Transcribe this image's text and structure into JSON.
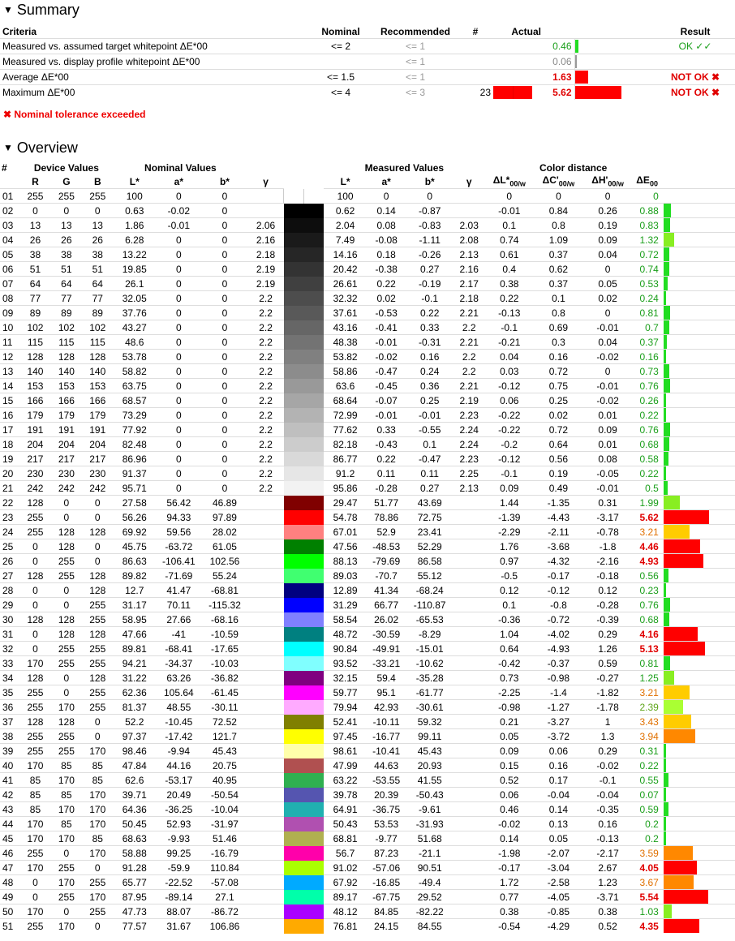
{
  "summary": {
    "title": "Summary",
    "headers": {
      "criteria": "Criteria",
      "nominal": "Nominal",
      "recommended": "Recommended",
      "count": "#",
      "actual": "Actual",
      "result": "Result"
    },
    "rows": [
      {
        "criteria": "Measured vs. assumed target whitepoint ΔE*00",
        "nominal": "<= 2",
        "recommended": "<= 1",
        "count": "",
        "actual": "0.46",
        "actual_color": "#1a9e1a",
        "result": "OK ✓✓",
        "result_color": "#1a9e1a",
        "bar_color": "#22dd22",
        "bar_fraction": 0.04,
        "count_bar": 0
      },
      {
        "criteria": "Measured vs. display profile whitepoint ΔE*00",
        "nominal": "",
        "recommended": "<= 1",
        "count": "",
        "actual": "0.06",
        "actual_color": "#888888",
        "result": "",
        "result_color": "#000000",
        "bar_color": "#999999",
        "bar_fraction": 0.01,
        "count_bar": 0
      },
      {
        "criteria": "Average ΔE*00",
        "nominal": "<= 1.5",
        "recommended": "<= 1",
        "count": "",
        "actual": "1.63",
        "actual_color": "#e00000",
        "result": "NOT OK ✖",
        "result_color": "#e00000",
        "bar_color": "#ff0000",
        "bar_fraction": 0.15,
        "count_bar": 0
      },
      {
        "criteria": "Maximum ΔE*00",
        "nominal": "<= 4",
        "recommended": "<= 3",
        "count": "23",
        "actual": "5.62",
        "actual_color": "#e00000",
        "result": "NOT OK ✖",
        "result_color": "#e00000",
        "bar_color": "#ff0000",
        "bar_fraction": 0.55,
        "count_bar": 1
      }
    ],
    "warning": "✖ Nominal tolerance exceeded"
  },
  "overview": {
    "title": "Overview",
    "group_headers": {
      "num": "#",
      "device": "Device Values",
      "nominal": "Nominal Values",
      "measured": "Measured Values",
      "distance": "Color distance"
    },
    "col_headers": {
      "r": "R",
      "g": "G",
      "b": "B",
      "l": "L*",
      "a": "a*",
      "bb": "b*",
      "gamma": "γ",
      "dl": "ΔL*",
      "dc": "ΔC'",
      "dh": "ΔH'",
      "de": "ΔE",
      "sub_w": "00/w",
      "sub_00": "00"
    },
    "rows": [
      [
        "01",
        "255",
        "255",
        "255",
        "100",
        "0",
        "0",
        "",
        "#ffffff",
        "#ffffff",
        "100",
        "0",
        "0",
        "",
        "0",
        "0",
        "0",
        "0"
      ],
      [
        "02",
        "0",
        "0",
        "0",
        "0.63",
        "-0.02",
        "0",
        "",
        "#000000",
        "#000000",
        "0.62",
        "0.14",
        "-0.87",
        "",
        "-0.01",
        "0.84",
        "0.26",
        "0.88"
      ],
      [
        "03",
        "13",
        "13",
        "13",
        "1.86",
        "-0.01",
        "0",
        "2.06",
        "#0d0d0d",
        "#0d0d0d",
        "2.04",
        "0.08",
        "-0.83",
        "2.03",
        "0.1",
        "0.8",
        "0.19",
        "0.83"
      ],
      [
        "04",
        "26",
        "26",
        "26",
        "6.28",
        "0",
        "0",
        "2.16",
        "#1a1a1a",
        "#1a1a1a",
        "7.49",
        "-0.08",
        "-1.11",
        "2.08",
        "0.74",
        "1.09",
        "0.09",
        "1.32"
      ],
      [
        "05",
        "38",
        "38",
        "38",
        "13.22",
        "0",
        "0",
        "2.18",
        "#262626",
        "#262626",
        "14.16",
        "0.18",
        "-0.26",
        "2.13",
        "0.61",
        "0.37",
        "0.04",
        "0.72"
      ],
      [
        "06",
        "51",
        "51",
        "51",
        "19.85",
        "0",
        "0",
        "2.19",
        "#333333",
        "#333333",
        "20.42",
        "-0.38",
        "0.27",
        "2.16",
        "0.4",
        "0.62",
        "0",
        "0.74"
      ],
      [
        "07",
        "64",
        "64",
        "64",
        "26.1",
        "0",
        "0",
        "2.19",
        "#404040",
        "#404040",
        "26.61",
        "0.22",
        "-0.19",
        "2.17",
        "0.38",
        "0.37",
        "0.05",
        "0.53"
      ],
      [
        "08",
        "77",
        "77",
        "77",
        "32.05",
        "0",
        "0",
        "2.2",
        "#4d4d4d",
        "#4d4d4d",
        "32.32",
        "0.02",
        "-0.1",
        "2.18",
        "0.22",
        "0.1",
        "0.02",
        "0.24"
      ],
      [
        "09",
        "89",
        "89",
        "89",
        "37.76",
        "0",
        "0",
        "2.2",
        "#595959",
        "#595959",
        "37.61",
        "-0.53",
        "0.22",
        "2.21",
        "-0.13",
        "0.8",
        "0",
        "0.81"
      ],
      [
        "10",
        "102",
        "102",
        "102",
        "43.27",
        "0",
        "0",
        "2.2",
        "#666666",
        "#666666",
        "43.16",
        "-0.41",
        "0.33",
        "2.2",
        "-0.1",
        "0.69",
        "-0.01",
        "0.7"
      ],
      [
        "11",
        "115",
        "115",
        "115",
        "48.6",
        "0",
        "0",
        "2.2",
        "#737373",
        "#737373",
        "48.38",
        "-0.01",
        "-0.31",
        "2.21",
        "-0.21",
        "0.3",
        "0.04",
        "0.37"
      ],
      [
        "12",
        "128",
        "128",
        "128",
        "53.78",
        "0",
        "0",
        "2.2",
        "#808080",
        "#808080",
        "53.82",
        "-0.02",
        "0.16",
        "2.2",
        "0.04",
        "0.16",
        "-0.02",
        "0.16"
      ],
      [
        "13",
        "140",
        "140",
        "140",
        "58.82",
        "0",
        "0",
        "2.2",
        "#8c8c8c",
        "#8c8c8c",
        "58.86",
        "-0.47",
        "0.24",
        "2.2",
        "0.03",
        "0.72",
        "0",
        "0.73"
      ],
      [
        "14",
        "153",
        "153",
        "153",
        "63.75",
        "0",
        "0",
        "2.2",
        "#999999",
        "#999999",
        "63.6",
        "-0.45",
        "0.36",
        "2.21",
        "-0.12",
        "0.75",
        "-0.01",
        "0.76"
      ],
      [
        "15",
        "166",
        "166",
        "166",
        "68.57",
        "0",
        "0",
        "2.2",
        "#a6a6a6",
        "#a6a6a6",
        "68.64",
        "-0.07",
        "0.25",
        "2.19",
        "0.06",
        "0.25",
        "-0.02",
        "0.26"
      ],
      [
        "16",
        "179",
        "179",
        "179",
        "73.29",
        "0",
        "0",
        "2.2",
        "#b3b3b3",
        "#b3b3b3",
        "72.99",
        "-0.01",
        "-0.01",
        "2.23",
        "-0.22",
        "0.02",
        "0.01",
        "0.22"
      ],
      [
        "17",
        "191",
        "191",
        "191",
        "77.92",
        "0",
        "0",
        "2.2",
        "#bfbfbf",
        "#bfbfbf",
        "77.62",
        "0.33",
        "-0.55",
        "2.24",
        "-0.22",
        "0.72",
        "0.09",
        "0.76"
      ],
      [
        "18",
        "204",
        "204",
        "204",
        "82.48",
        "0",
        "0",
        "2.2",
        "#cccccc",
        "#cccccc",
        "82.18",
        "-0.43",
        "0.1",
        "2.24",
        "-0.2",
        "0.64",
        "0.01",
        "0.68"
      ],
      [
        "19",
        "217",
        "217",
        "217",
        "86.96",
        "0",
        "0",
        "2.2",
        "#d9d9d9",
        "#d9d9d9",
        "86.77",
        "0.22",
        "-0.47",
        "2.23",
        "-0.12",
        "0.56",
        "0.08",
        "0.58"
      ],
      [
        "20",
        "230",
        "230",
        "230",
        "91.37",
        "0",
        "0",
        "2.2",
        "#e6e6e6",
        "#e6e6e6",
        "91.2",
        "0.11",
        "0.11",
        "2.25",
        "-0.1",
        "0.19",
        "-0.05",
        "0.22"
      ],
      [
        "21",
        "242",
        "242",
        "242",
        "95.71",
        "0",
        "0",
        "2.2",
        "#f2f2f2",
        "#f2f2f2",
        "95.86",
        "-0.28",
        "0.27",
        "2.13",
        "0.09",
        "0.49",
        "-0.01",
        "0.5"
      ],
      [
        "22",
        "128",
        "0",
        "0",
        "27.58",
        "56.42",
        "46.89",
        "",
        "#800000",
        "#800000",
        "29.47",
        "51.77",
        "43.69",
        "",
        "1.44",
        "-1.35",
        "0.31",
        "1.99"
      ],
      [
        "23",
        "255",
        "0",
        "0",
        "56.26",
        "94.33",
        "97.89",
        "",
        "#ff0000",
        "#ff0000",
        "54.78",
        "78.86",
        "72.75",
        "",
        "-1.39",
        "-4.43",
        "-3.17",
        "5.62"
      ],
      [
        "24",
        "255",
        "128",
        "128",
        "69.92",
        "59.56",
        "28.02",
        "",
        "#ff8080",
        "#ff8080",
        "67.01",
        "52.9",
        "23.41",
        "",
        "-2.29",
        "-2.11",
        "-0.78",
        "3.21"
      ],
      [
        "25",
        "0",
        "128",
        "0",
        "45.75",
        "-63.72",
        "61.05",
        "",
        "#008000",
        "#008000",
        "47.56",
        "-48.53",
        "52.29",
        "",
        "1.76",
        "-3.68",
        "-1.8",
        "4.46"
      ],
      [
        "26",
        "0",
        "255",
        "0",
        "86.63",
        "-106.41",
        "102.56",
        "",
        "#00ff00",
        "#00ff00",
        "88.13",
        "-79.69",
        "86.58",
        "",
        "0.97",
        "-4.32",
        "-2.16",
        "4.93"
      ],
      [
        "27",
        "128",
        "255",
        "128",
        "89.82",
        "-71.69",
        "55.24",
        "",
        "#40ff70",
        "#40ff70",
        "89.03",
        "-70.7",
        "55.12",
        "",
        "-0.5",
        "-0.17",
        "-0.18",
        "0.56"
      ],
      [
        "28",
        "0",
        "0",
        "128",
        "12.7",
        "41.47",
        "-68.81",
        "",
        "#000080",
        "#000080",
        "12.89",
        "41.34",
        "-68.24",
        "",
        "0.12",
        "-0.12",
        "0.12",
        "0.23"
      ],
      [
        "29",
        "0",
        "0",
        "255",
        "31.17",
        "70.11",
        "-115.32",
        "",
        "#0000ff",
        "#0000ff",
        "31.29",
        "66.77",
        "-110.87",
        "",
        "0.1",
        "-0.8",
        "-0.28",
        "0.76"
      ],
      [
        "30",
        "128",
        "128",
        "255",
        "58.95",
        "27.66",
        "-68.16",
        "",
        "#8080ff",
        "#8080ff",
        "58.54",
        "26.02",
        "-65.53",
        "",
        "-0.36",
        "-0.72",
        "-0.39",
        "0.68"
      ],
      [
        "31",
        "0",
        "128",
        "128",
        "47.66",
        "-41",
        "-10.59",
        "",
        "#008080",
        "#008080",
        "48.72",
        "-30.59",
        "-8.29",
        "",
        "1.04",
        "-4.02",
        "0.29",
        "4.16"
      ],
      [
        "32",
        "0",
        "255",
        "255",
        "89.81",
        "-68.41",
        "-17.65",
        "",
        "#00ffff",
        "#00ffff",
        "90.84",
        "-49.91",
        "-15.01",
        "",
        "0.64",
        "-4.93",
        "1.26",
        "5.13"
      ],
      [
        "33",
        "170",
        "255",
        "255",
        "94.21",
        "-34.37",
        "-10.03",
        "",
        "#80ffff",
        "#80ffff",
        "93.52",
        "-33.21",
        "-10.62",
        "",
        "-0.42",
        "-0.37",
        "0.59",
        "0.81"
      ],
      [
        "34",
        "128",
        "0",
        "128",
        "31.22",
        "63.26",
        "-36.82",
        "",
        "#800080",
        "#800080",
        "32.15",
        "59.4",
        "-35.28",
        "",
        "0.73",
        "-0.98",
        "-0.27",
        "1.25"
      ],
      [
        "35",
        "255",
        "0",
        "255",
        "62.36",
        "105.64",
        "-61.45",
        "",
        "#ff00ff",
        "#ff00ff",
        "59.77",
        "95.1",
        "-61.77",
        "",
        "-2.25",
        "-1.4",
        "-1.82",
        "3.21"
      ],
      [
        "36",
        "255",
        "170",
        "255",
        "81.37",
        "48.55",
        "-30.11",
        "",
        "#ffaaff",
        "#ffaaff",
        "79.94",
        "42.93",
        "-30.61",
        "",
        "-0.98",
        "-1.27",
        "-1.78",
        "2.39"
      ],
      [
        "37",
        "128",
        "128",
        "0",
        "52.2",
        "-10.45",
        "72.52",
        "",
        "#808000",
        "#808000",
        "52.41",
        "-10.11",
        "59.32",
        "",
        "0.21",
        "-3.27",
        "1",
        "3.43"
      ],
      [
        "38",
        "255",
        "255",
        "0",
        "97.37",
        "-17.42",
        "121.7",
        "",
        "#ffff00",
        "#ffff00",
        "97.45",
        "-16.77",
        "99.11",
        "",
        "0.05",
        "-3.72",
        "1.3",
        "3.94"
      ],
      [
        "39",
        "255",
        "255",
        "170",
        "98.46",
        "-9.94",
        "45.43",
        "",
        "#ffffaa",
        "#ffffaa",
        "98.61",
        "-10.41",
        "45.43",
        "",
        "0.09",
        "0.06",
        "0.29",
        "0.31"
      ],
      [
        "40",
        "170",
        "85",
        "85",
        "47.84",
        "44.16",
        "20.75",
        "",
        "#b05050",
        "#b05050",
        "47.99",
        "44.63",
        "20.93",
        "",
        "0.15",
        "0.16",
        "-0.02",
        "0.22"
      ],
      [
        "41",
        "85",
        "170",
        "85",
        "62.6",
        "-53.17",
        "40.95",
        "",
        "#2fb050",
        "#2fb050",
        "63.22",
        "-53.55",
        "41.55",
        "",
        "0.52",
        "0.17",
        "-0.1",
        "0.55"
      ],
      [
        "42",
        "85",
        "85",
        "170",
        "39.71",
        "20.49",
        "-50.54",
        "",
        "#5555b0",
        "#5555b0",
        "39.78",
        "20.39",
        "-50.43",
        "",
        "0.06",
        "-0.04",
        "-0.04",
        "0.07"
      ],
      [
        "43",
        "85",
        "170",
        "170",
        "64.36",
        "-36.25",
        "-10.04",
        "",
        "#20b0b0",
        "#20b0b0",
        "64.91",
        "-36.75",
        "-9.61",
        "",
        "0.46",
        "0.14",
        "-0.35",
        "0.59"
      ],
      [
        "44",
        "170",
        "85",
        "170",
        "50.45",
        "52.93",
        "-31.97",
        "",
        "#b050b0",
        "#b050b0",
        "50.43",
        "53.53",
        "-31.93",
        "",
        "-0.02",
        "0.13",
        "0.16",
        "0.2"
      ],
      [
        "45",
        "170",
        "170",
        "85",
        "68.63",
        "-9.93",
        "51.46",
        "",
        "#b0b050",
        "#b0b050",
        "68.81",
        "-9.77",
        "51.68",
        "",
        "0.14",
        "0.05",
        "-0.13",
        "0.2"
      ],
      [
        "46",
        "255",
        "0",
        "170",
        "58.88",
        "99.25",
        "-16.79",
        "",
        "#ff00aa",
        "#ff00aa",
        "56.7",
        "87.23",
        "-21.1",
        "",
        "-1.98",
        "-2.07",
        "-2.17",
        "3.59"
      ],
      [
        "47",
        "170",
        "255",
        "0",
        "91.28",
        "-59.9",
        "110.84",
        "",
        "#aaff00",
        "#aaff00",
        "91.02",
        "-57.06",
        "90.51",
        "",
        "-0.17",
        "-3.04",
        "2.67",
        "4.05"
      ],
      [
        "48",
        "0",
        "170",
        "255",
        "65.77",
        "-22.52",
        "-57.08",
        "",
        "#00aaff",
        "#00aaff",
        "67.92",
        "-16.85",
        "-49.4",
        "",
        "1.72",
        "-2.58",
        "1.23",
        "3.67"
      ],
      [
        "49",
        "0",
        "255",
        "170",
        "87.95",
        "-89.14",
        "27.1",
        "",
        "#00ffaa",
        "#00ffaa",
        "89.17",
        "-67.75",
        "29.52",
        "",
        "0.77",
        "-4.05",
        "-3.71",
        "5.54"
      ],
      [
        "50",
        "170",
        "0",
        "255",
        "47.73",
        "88.07",
        "-86.72",
        "",
        "#aa00ff",
        "#aa00ff",
        "48.12",
        "84.85",
        "-82.22",
        "",
        "0.38",
        "-0.85",
        "0.38",
        "1.03"
      ],
      [
        "51",
        "255",
        "170",
        "0",
        "77.57",
        "31.67",
        "106.86",
        "",
        "#ffaa00",
        "#ffaa00",
        "76.81",
        "24.15",
        "84.55",
        "",
        "-0.54",
        "-4.29",
        "0.52",
        "4.35"
      ]
    ]
  }
}
